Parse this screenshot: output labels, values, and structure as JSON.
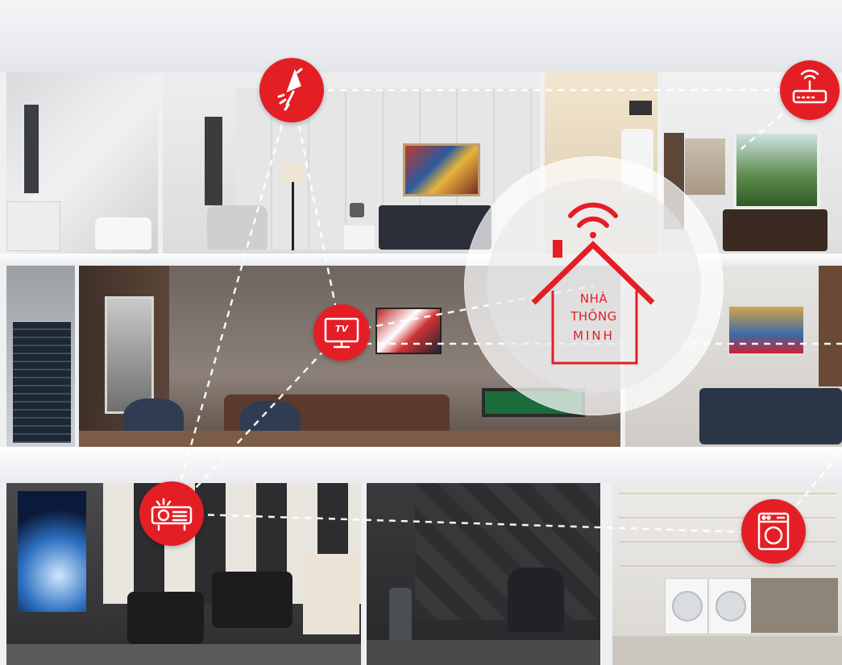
{
  "hub": {
    "line1": "NHÀ",
    "line2": "THÔNG",
    "line3": "MINH"
  },
  "tv_icon": {
    "label": "TV"
  },
  "colors": {
    "accent": "#e41e25",
    "hub_bg": "#ffffff",
    "connector": "#ffffff"
  },
  "icons": [
    "lamp-icon",
    "router-icon",
    "tv-icon",
    "projector-icon",
    "washing-machine-icon",
    "smart-home-wifi-icon"
  ]
}
